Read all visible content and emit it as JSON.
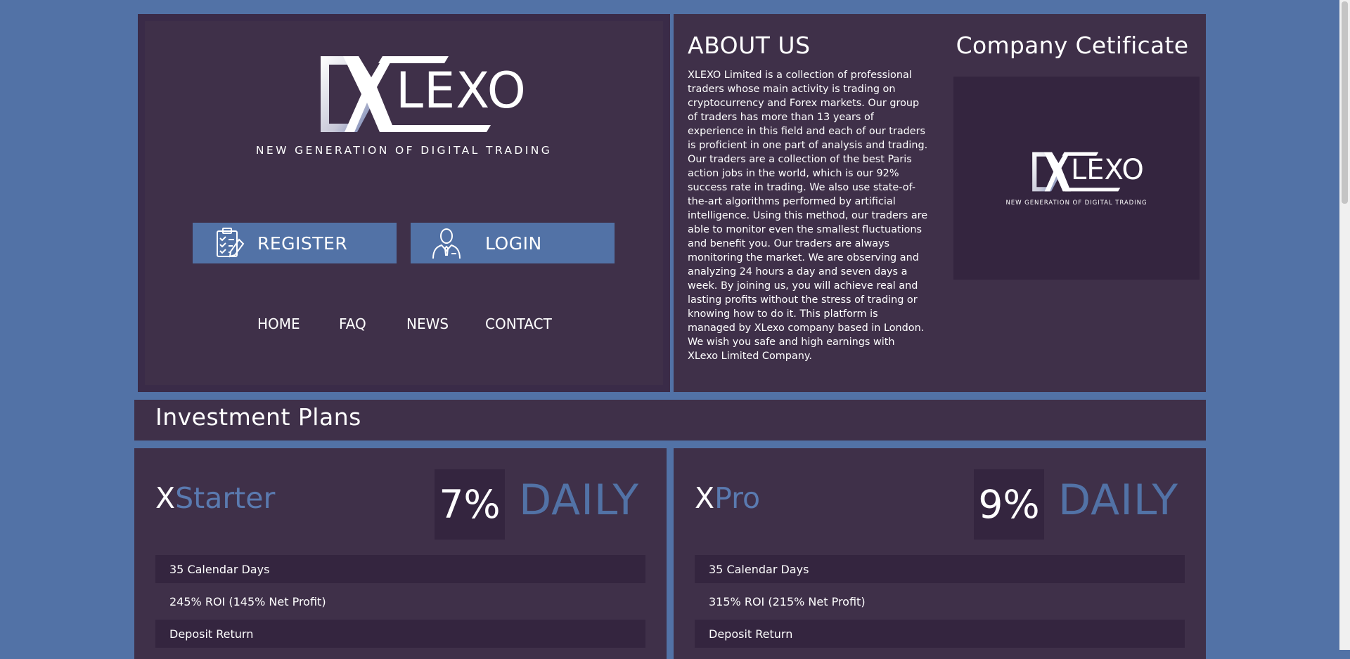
{
  "hero": {
    "logo_text": "LEXO",
    "tagline": "NEW GENERATION OF DIGITAL TRADING",
    "register_label": "REGISTER",
    "login_label": "LOGIN",
    "nav": [
      "HOME",
      "FAQ",
      "NEWS",
      "CONTACT"
    ]
  },
  "about": {
    "title": "ABOUT US",
    "paragraph": "XLEXO Limited is a collection of professional traders whose main activity is trading on cryptocurrency and Forex markets. Our group of traders has more than 13 years of experience in this field and each of our traders is proficient in one part of analysis and trading. Our traders are a collection of the best Paris action jobs in the world, which is our 92% success rate in trading. We also use state-of-the-art algorithms performed by artificial intelligence. Using this method, our traders are able to monitor even the smallest fluctuations and benefit you. Our traders are always monitoring the market. We are observing and analyzing 24 hours a day and seven days a week. By joining us, you will achieve real and lasting profits without the stress of trading or knowing how to do it. This platform is managed by XLexo company based in London.",
    "closing": "We wish you safe and high earnings with XLexo Limited Company."
  },
  "certificate": {
    "title": "Company Cetificate",
    "logo_text": "LEXO",
    "tagline": "NEW GENERATION OF DIGITAL TRADING"
  },
  "plans": {
    "title": "Investment Plans",
    "items": [
      {
        "name_prefix": "X",
        "name_rest": "Starter",
        "percent": "7%",
        "period": "DAILY",
        "rows": [
          "35 Calendar Days",
          "245% ROI (145% Net Profit)",
          "Deposit Return"
        ]
      },
      {
        "name_prefix": "X",
        "name_rest": "Pro",
        "percent": "9%",
        "period": "DAILY",
        "rows": [
          "35 Calendar Days",
          "315% ROI (215% Net Profit)",
          "Deposit Return"
        ]
      }
    ]
  },
  "colors": {
    "page_bg": "#5272a6",
    "panel": "#3f3049",
    "panel_dark": "#34253f",
    "accent": "#5272a6"
  }
}
